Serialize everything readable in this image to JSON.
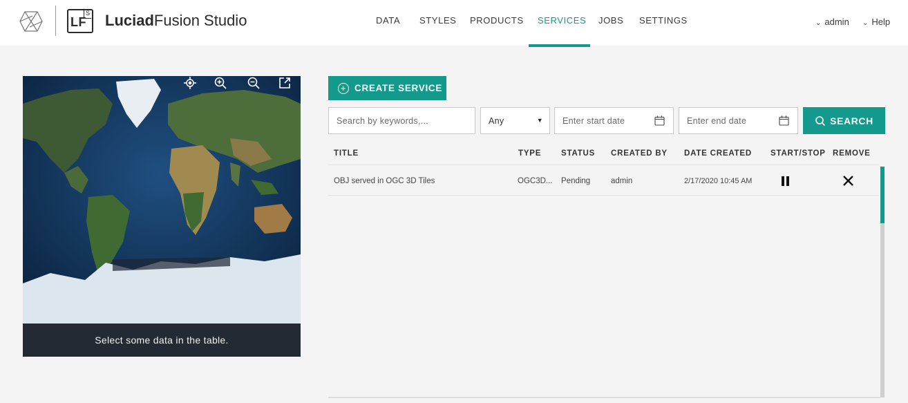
{
  "header": {
    "brand_bold": "Luciad",
    "brand_rest": "Fusion Studio",
    "lf_text": "LF",
    "lf_sup": "S",
    "nav": [
      {
        "label": "DATA",
        "active": false
      },
      {
        "label": "STYLES",
        "active": false
      },
      {
        "label": "PRODUCTS",
        "active": false
      },
      {
        "label": "SERVICES",
        "active": true
      },
      {
        "label": "JOBS",
        "active": false
      },
      {
        "label": "SETTINGS",
        "active": false
      }
    ],
    "user_label": "admin",
    "help_label": "Help",
    "chevron": "⌄"
  },
  "map": {
    "caption": "Select some data in the table.",
    "tools": [
      "locate-icon",
      "zoom-in-icon",
      "zoom-out-icon",
      "external-link-icon"
    ]
  },
  "actions": {
    "create_label": "CREATE SERVICE",
    "create_icon": "plus-circle-icon"
  },
  "filters": {
    "keyword_placeholder": "Search by keywords,...",
    "type_value": "Any",
    "start_placeholder": "Enter start date",
    "end_placeholder": "Enter end date",
    "search_label": "SEARCH"
  },
  "table": {
    "headers": [
      "TITLE",
      "TYPE",
      "STATUS",
      "CREATED BY",
      "DATE CREATED",
      "START/STOP",
      "REMOVE"
    ],
    "rows": [
      {
        "title": "OBJ served in OGC 3D Tiles",
        "type": "OGC3D...",
        "status": "Pending",
        "created_by": "admin",
        "date_created": "2/17/2020 10:45 AM",
        "start_stop": "pause-icon",
        "remove": "close-icon"
      }
    ]
  },
  "colors": {
    "accent": "#139a8c",
    "caption_bg": "#232a33",
    "page_bg": "#f4f4f4"
  }
}
